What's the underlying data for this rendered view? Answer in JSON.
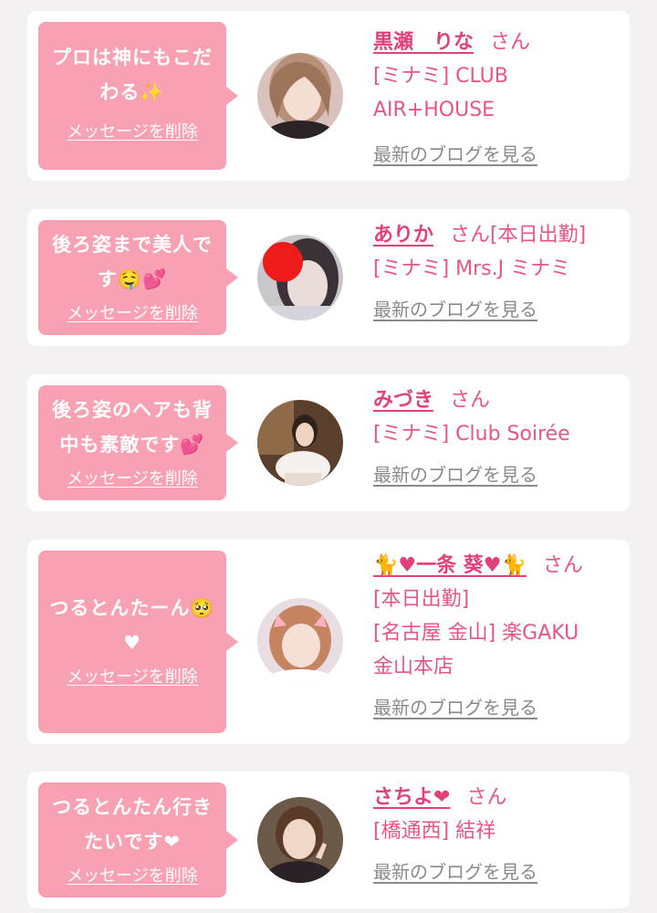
{
  "delete_label": "メッセージを削除",
  "blog_label": "最新のブログを見る",
  "honorific": "さん",
  "cards": [
    {
      "message_line1": "プロは神にもこだ",
      "message_line2": "わる✨",
      "name": "黒瀬　りな",
      "name_suffix": "",
      "shop_line1": "[ミナミ] CLUB",
      "shop_line2": "AIR+HOUSE",
      "shop_line3": ""
    },
    {
      "message_line1": "後ろ姿まで美人で",
      "message_line2": "す🤤💕",
      "name": "ありか",
      "name_suffix": "[本日出勤]",
      "shop_line1": "[ミナミ] Mrs.J ミナミ",
      "shop_line2": "",
      "shop_line3": ""
    },
    {
      "message_line1": "後ろ姿のヘアも背",
      "message_line2": "中も素敵です💕",
      "name": "みづき",
      "name_suffix": "",
      "shop_line1": "[ミナミ] Club Soirée",
      "shop_line2": "",
      "shop_line3": ""
    },
    {
      "message_line1": "つるとんたーん🥺",
      "message_line2": "♥",
      "name": "🐈♥一条 葵♥🐈",
      "name_suffix": "",
      "shop_line1": "[本日出勤]",
      "shop_line2": "[名古屋 金山] 楽GAKU",
      "shop_line3": "金山本店"
    },
    {
      "message_line1": "つるとんたん行き",
      "message_line2": "たいです❤",
      "name": "さちよ❤",
      "name_suffix": "",
      "shop_line1": "[橋通西] 結祥",
      "shop_line2": "",
      "shop_line3": ""
    }
  ]
}
